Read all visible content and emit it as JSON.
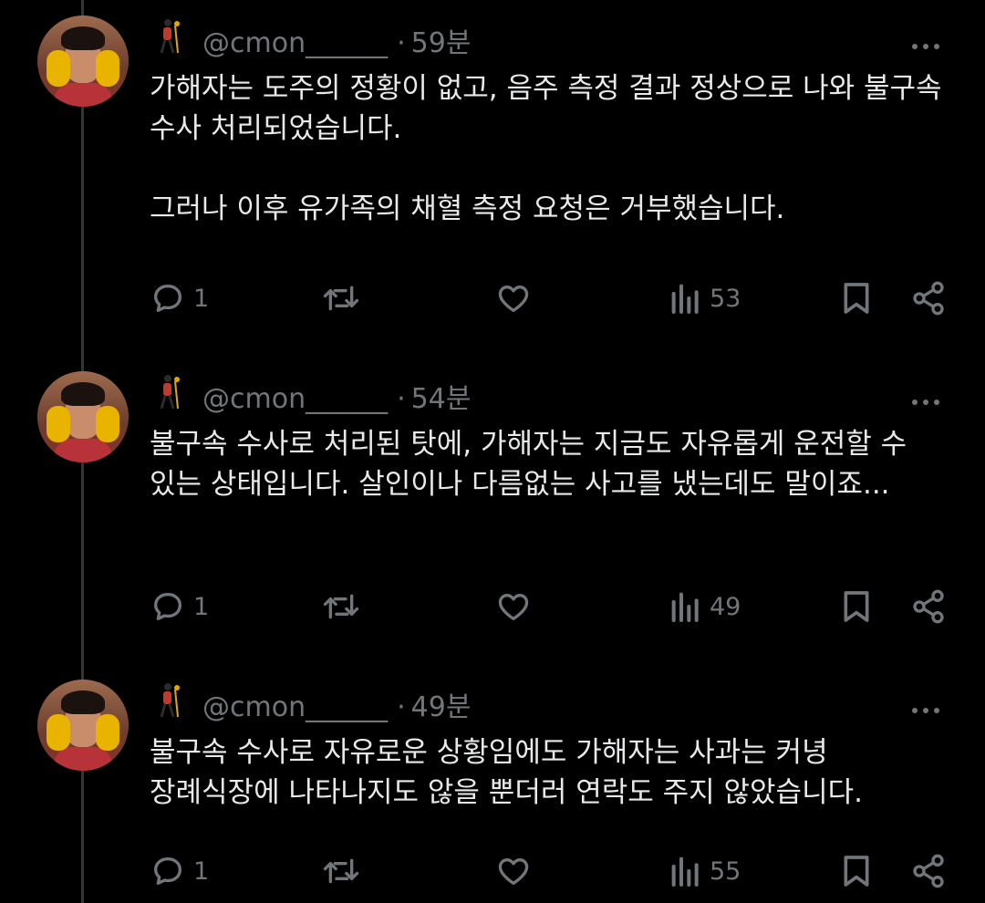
{
  "tweets": [
    {
      "author": "@cmon______",
      "time": "59분",
      "text": "가해자는 도주의 정황이 없고, 음주 측정 결과 정상으로 나와 불구속 수사 처리되었습니다.\n\n그러나 이후 유가족의 채혈 측정 요청은 거부했습니다.",
      "replies": "1",
      "views": "53"
    },
    {
      "author": "@cmon______",
      "time": "54분",
      "text": "불구속 수사로 처리된 탓에, 가해자는 지금도 자유롭게 운전할 수 있는 상태입니다. 살인이나 다름없는 사고를 냈는데도 말이죠...",
      "replies": "1",
      "views": "49"
    },
    {
      "author": "@cmon______",
      "time": "49분",
      "text": "불구속 수사로 자유로운 상황임에도 가해자는 사과는 커녕 장례식장에 나타나지도 않을 뿐더러 연락도 주지 않았습니다.",
      "replies": "1",
      "views": "55"
    }
  ],
  "separator": "·",
  "icons": {
    "reply": "reply-icon",
    "retweet": "retweet-icon",
    "like": "heart-icon",
    "views": "views-icon",
    "bookmark": "bookmark-icon",
    "share": "share-icon",
    "more": "more-icon",
    "emoji": "person-walking-cane-emoji"
  },
  "colors": {
    "background": "#000000",
    "text": "#e7e9ea",
    "muted": "#71767b",
    "thread_line": "#333639"
  }
}
